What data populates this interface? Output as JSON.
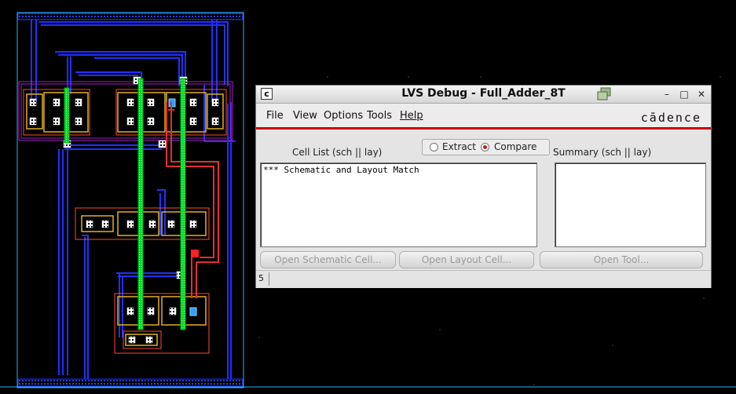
{
  "dialog": {
    "title": "LVS Debug - Full_Adder_8T",
    "app_icon_glyph": "c",
    "menu": [
      "File",
      "View",
      "Options",
      "Tools",
      "Help"
    ],
    "brand": "cādence",
    "window_controls": {
      "minimize": "–",
      "maximize": "□",
      "close": "✕"
    },
    "cell_list_label": "Cell List (sch || lay)",
    "summary_label": "Summary (sch || lay)",
    "mode": {
      "extract_label": "Extract",
      "compare_label": "Compare",
      "selected": "Compare"
    },
    "cell_list_items": [
      "*** Schematic and Layout Match"
    ],
    "buttons": {
      "open_schematic": "Open Schematic Cell...",
      "open_layout": "Open Layout Cell...",
      "open_tool": "Open Tool..."
    },
    "status_count": "5"
  },
  "colors": {
    "metal1": "#2030ff",
    "poly": "#ff3030",
    "active": "#2fdc2f",
    "nwell": "#a020c0",
    "boundary": "#27b6e8",
    "accent_red": "#c00000"
  },
  "icons": [
    "cadence-app-icon",
    "copy-windows-icon",
    "minimize-icon",
    "maximize-icon",
    "close-icon"
  ]
}
